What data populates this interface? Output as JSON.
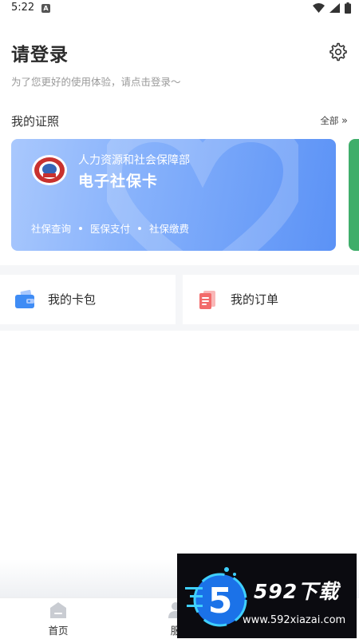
{
  "status_bar": {
    "time": "5:22",
    "icons": [
      "app-notification-icon",
      "wifi-icon",
      "signal-icon",
      "battery-icon"
    ]
  },
  "header": {
    "title": "请登录",
    "subtitle": "为了您更好的使用体验，请点击登录～",
    "settings_icon": "gear-icon"
  },
  "certificates": {
    "section_title": "我的证照",
    "all_label": "全部",
    "cards": [
      {
        "issuer": "人力资源和社会保障部",
        "name": "电子社保卡",
        "features": [
          "社保查询",
          "医保支付",
          "社保缴费"
        ],
        "color": "#5b92f6"
      }
    ],
    "peek_card_color": "#3fae6a"
  },
  "quick_actions": [
    {
      "label": "我的卡包",
      "icon": "wallet-icon",
      "color": "#3f8cf5"
    },
    {
      "label": "我的订单",
      "icon": "order-list-icon",
      "color": "#f26b6b"
    }
  ],
  "bottom_nav": [
    {
      "label": "首页",
      "icon": "home-icon"
    },
    {
      "label": "服",
      "icon": "service-icon"
    }
  ],
  "watermark": {
    "badge": "5",
    "title": "592下载",
    "url": "www.592xiazai.com"
  }
}
